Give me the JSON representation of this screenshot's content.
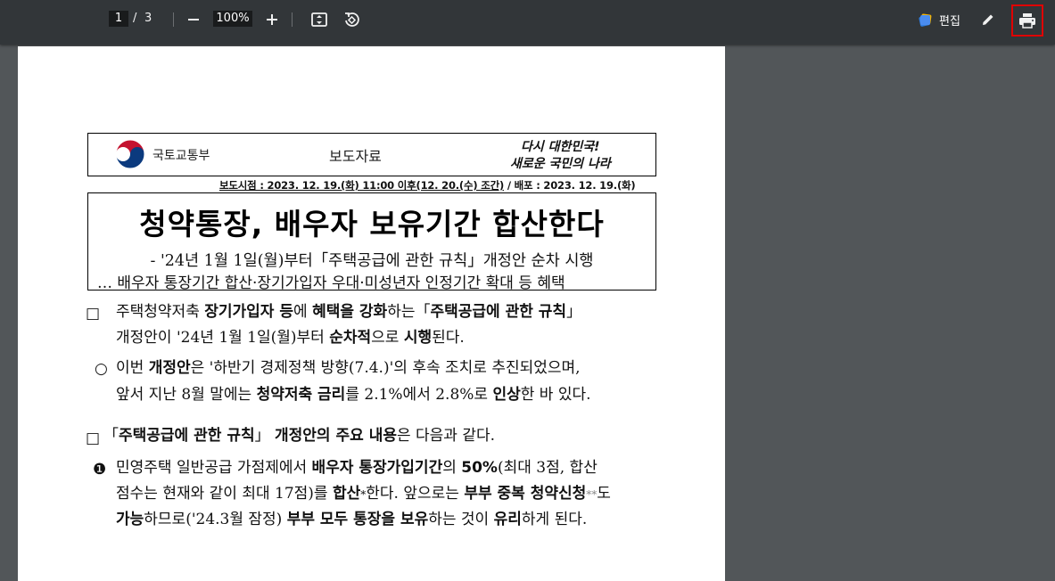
{
  "toolbar": {
    "current_page": "1",
    "page_separator": "/",
    "total_pages": "3",
    "zoom": "100%",
    "edit_label": "편집"
  },
  "document": {
    "ministry_name": "국토교통부",
    "press_label": "보도자료",
    "slogan_line1": "다시 대한민국!",
    "slogan_line2": "새로운 국민의 나라",
    "release_prefix": "보도시점 : 2023. 12. 19.(화) 11:00 이후(12. 20.(수) 조간)",
    "release_suffix": " / 배포 : 2023. 12. 19.(화)",
    "title": "청약통장, 배우자 보유기간 합산한다",
    "subtitle1": "- '24년 1월 1일(월)부터「주택공급에 관한 규칙」개정안 순차 시행",
    "subtitle2": "… 배우자 통장기간 합산·장기가입자 우대·미성년자 인정기간 확대 등 혜택",
    "p1_bullet": "□",
    "p1_a": "주택청약저축 ",
    "p1_b": "장기가입자 등",
    "p1_c": "에 ",
    "p1_d": "혜택을 강화",
    "p1_e": "하는「",
    "p1_f": "주택공급에 관한 규칙",
    "p1_g": "」",
    "p1_line2_a": "개정안이 '24년 1월 1일(월)부터 ",
    "p1_line2_b": "순차적",
    "p1_line2_c": "으로 ",
    "p1_line2_d": "시행",
    "p1_line2_e": "된다.",
    "p2_bullet": "○",
    "p2_a": "이번 ",
    "p2_b": "개정안",
    "p2_c": "은 '하반기 경제정책 방향(7.4.)'의 후속 조치로 추진되었으며,",
    "p2_line2_a": "앞서 지난 8월 말에는 ",
    "p2_line2_b": "청약저축 금리",
    "p2_line2_c": "를 2.1%에서 2.8%로 ",
    "p2_line2_d": "인상",
    "p2_line2_e": "한 바 있다.",
    "p3_bullet": "□",
    "p3_a": "「",
    "p3_b": "주택공급에 관한 규칙",
    "p3_c": "」 ",
    "p3_d": "개정안의 주요 내용",
    "p3_e": "은 다음과 같다.",
    "p4_bullet": "❶",
    "p4_a": "민영주택 일반공급 가점제에서 ",
    "p4_b": "배우자 통장가입기간",
    "p4_c": "의 ",
    "p4_d": "50%",
    "p4_e": "(최대 3점, 합산",
    "p4_line2_a": "점수는 현재와 같이 최대 17점)를 ",
    "p4_line2_b": "합산",
    "p4_line2_c": "*",
    "p4_line2_d": "한다. 앞으로는 ",
    "p4_line2_e": "부부 중복 청약신청",
    "p4_line2_f": "**",
    "p4_line2_g": "도",
    "p4_line3_a": "가능",
    "p4_line3_b": "하므로('24.3월 잠정) ",
    "p4_line3_c": "부부 모두 통장을 보유",
    "p4_line3_d": "하는 것이 ",
    "p4_line3_e": "유리",
    "p4_line3_f": "하게 된다."
  }
}
